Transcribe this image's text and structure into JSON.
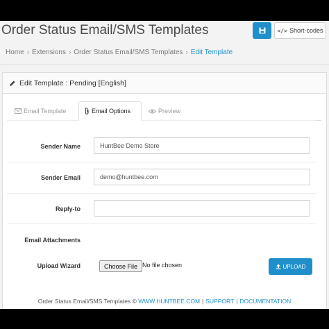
{
  "header": {
    "title": "Order Status Email/SMS Templates",
    "shortcodes_label": "Short-codes",
    "shortcodes_glyph": "</>",
    "save_icon": "floppy-disk-icon"
  },
  "breadcrumb": {
    "items": [
      "Home",
      "Extensions",
      "Order Status Email/SMS Templates",
      "Edit Template"
    ],
    "separator": "›"
  },
  "panel": {
    "heading": "Edit Template : Pending [English]",
    "heading_icon": "pencil-icon"
  },
  "tabs": [
    {
      "label": "Email Template",
      "icon": "envelope-icon",
      "active": false
    },
    {
      "label": "Email Options",
      "icon": "paperclip-icon",
      "active": true
    },
    {
      "label": "Preview",
      "icon": "eye-icon",
      "active": false
    }
  ],
  "form": {
    "sender_name": {
      "label": "Sender Name",
      "value": "HuntBee Demo Store"
    },
    "sender_email": {
      "label": "Sender Email",
      "value": "demo@huntbee.com"
    },
    "reply_to": {
      "label": "Reply-to",
      "value": ""
    },
    "attachments_label": "Email Attachments",
    "upload_wizard": {
      "label": "Upload Wizard",
      "choose_file_label": "Choose File",
      "no_file_text": "No file chosen",
      "upload_label": "UPLOAD"
    }
  },
  "footer": {
    "prefix": "Order Status Email/SMS Templates ©",
    "links": [
      "WWW.HUNTBEE.COM",
      "SUPPORT",
      "DOCUMENTATION"
    ],
    "separator": "|"
  },
  "colors": {
    "accent": "#1f8fcb",
    "link": "#1e91cf",
    "frame": "#000000",
    "background": "#f3f3f3"
  }
}
